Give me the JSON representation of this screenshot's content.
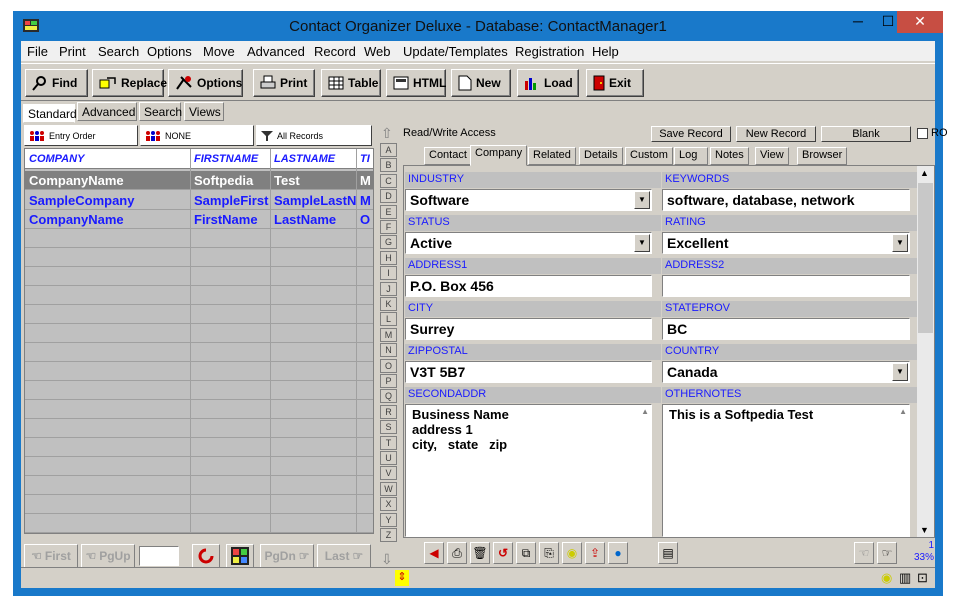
{
  "window": {
    "title": "Contact Organizer Deluxe - Database: ContactManager1",
    "controls": [
      "─",
      "☐",
      "✕"
    ]
  },
  "menu": [
    "File",
    "Print",
    "Search",
    "Options",
    "Move",
    "Advanced",
    "Record",
    "Web",
    "Update/Templates",
    "Registration",
    "Help"
  ],
  "toolbar": {
    "find": "Find",
    "replace": "Replace",
    "options": "Options",
    "print": "Print",
    "table": "Table",
    "html": "HTML",
    "new": "New",
    "load": "Load",
    "exit": "Exit"
  },
  "mode_tabs": [
    "Standard",
    "Advanced",
    "Search",
    "Views"
  ],
  "sort_bar": {
    "entry_order": "Entry Order",
    "none": "NONE",
    "all_records": "All Records"
  },
  "grid": {
    "columns": [
      "COMPANY",
      "FIRSTNAME",
      "LASTNAME",
      "TI"
    ],
    "rows": [
      [
        "CompanyName",
        "Softpedia",
        "Test",
        "M"
      ],
      [
        "SampleCompany",
        "SampleFirst",
        "SampleLastN",
        "M"
      ],
      [
        "CompanyName",
        "FirstName",
        "LastName",
        "O"
      ]
    ]
  },
  "nav": {
    "first": "First",
    "pgup": "PgUp",
    "pgdn": "PgDn",
    "last": "Last",
    "record_value": ""
  },
  "alphabet": [
    "A",
    "B",
    "C",
    "D",
    "E",
    "F",
    "G",
    "H",
    "I",
    "J",
    "K",
    "L",
    "M",
    "N",
    "O",
    "P",
    "Q",
    "R",
    "S",
    "T",
    "U",
    "V",
    "W",
    "X",
    "Y",
    "Z"
  ],
  "access": {
    "label": "Read/Write Access",
    "save": "Save Record",
    "new": "New Record",
    "blank": "Blank",
    "ro": "RO"
  },
  "record_tabs": [
    "Contact",
    "Company",
    "Related",
    "Details",
    "Custom",
    "Log",
    "Notes",
    "View",
    "Browser"
  ],
  "fields": {
    "industry": {
      "label": "INDUSTRY",
      "value": "Software"
    },
    "keywords": {
      "label": "KEYWORDS",
      "value": "software, database, network"
    },
    "status": {
      "label": "STATUS",
      "value": "Active"
    },
    "rating": {
      "label": "RATING",
      "value": "Excellent"
    },
    "address1": {
      "label": "ADDRESS1",
      "value": "P.O. Box 456"
    },
    "address2": {
      "label": "ADDRESS2",
      "value": ""
    },
    "city": {
      "label": "CITY",
      "value": "Surrey"
    },
    "stateprov": {
      "label": "STATEPROV",
      "value": "BC"
    },
    "zippostal": {
      "label": "ZIPPOSTAL",
      "value": "V3T 5B7"
    },
    "country": {
      "label": "COUNTRY",
      "value": "Canada"
    },
    "secondaddr": {
      "label": "SECONDADDR",
      "lines": [
        "Business Name",
        "address 1",
        "city,   state   zip"
      ]
    },
    "othernotes": {
      "label": "OTHERNOTES",
      "value": "This is a Softpedia Test"
    }
  },
  "record_counter": {
    "current": "1",
    "percent": "33%"
  },
  "colors": {
    "title_bar": "#1979ca",
    "label_blue": "#1a1aff",
    "selected_row": "#808080",
    "face": "#d4d0c8"
  }
}
